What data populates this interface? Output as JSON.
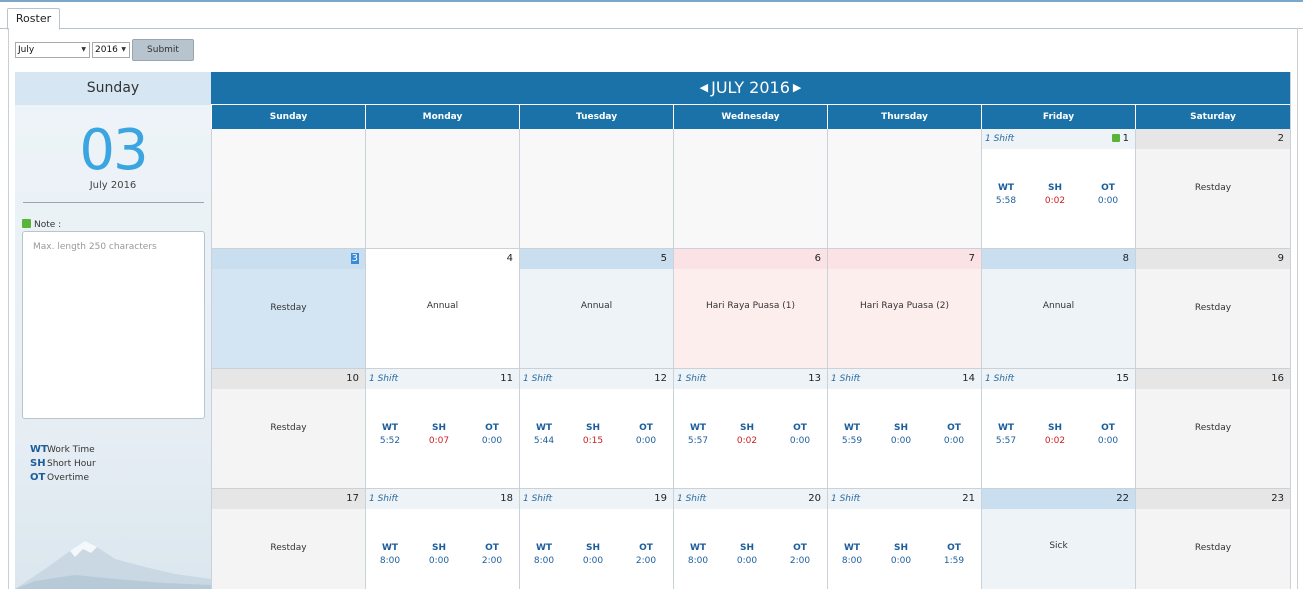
{
  "tab": {
    "label": "Roster"
  },
  "controls": {
    "month": "July",
    "year": "2016",
    "submit_label": "Submit"
  },
  "side": {
    "day_name": "Sunday",
    "date_num": "03",
    "month_year": "July 2016",
    "note_label": "Note :",
    "note_placeholder": "Max. length 250 characters",
    "legend": [
      {
        "key": "WT",
        "text": "Work Time"
      },
      {
        "key": "SH",
        "text": "Short Hour"
      },
      {
        "key": "OT",
        "text": "Overtime"
      }
    ]
  },
  "calendar": {
    "title": "JULY 2016",
    "weekdays": [
      "Sunday",
      "Monday",
      "Tuesday",
      "Wednesday",
      "Thursday",
      "Friday",
      "Saturday"
    ],
    "stat_keys": [
      "WT",
      "SH",
      "OT"
    ],
    "weeks": [
      [
        {
          "num": "",
          "kind": "empty"
        },
        {
          "num": "",
          "kind": "empty"
        },
        {
          "num": "",
          "kind": "empty"
        },
        {
          "num": "",
          "kind": "empty"
        },
        {
          "num": "",
          "kind": "empty"
        },
        {
          "num": "1",
          "kind": "shift",
          "shift": "1 Shift",
          "flag": true,
          "wt": "5:58",
          "sh": "0:02",
          "ot": "0:00",
          "sh_red": true
        },
        {
          "num": "2",
          "kind": "label",
          "label": "Restday",
          "tone": "gray"
        }
      ],
      [
        {
          "num": "3",
          "kind": "label",
          "label": "Restday",
          "tone": "selected"
        },
        {
          "num": "4",
          "kind": "label",
          "label": "Annual",
          "tone": "plain"
        },
        {
          "num": "5",
          "kind": "label",
          "label": "Annual",
          "tone": "plainblue"
        },
        {
          "num": "6",
          "kind": "label",
          "label": "Hari Raya Puasa (1)",
          "tone": "pink"
        },
        {
          "num": "7",
          "kind": "label",
          "label": "Hari Raya Puasa (2)",
          "tone": "pink"
        },
        {
          "num": "8",
          "kind": "label",
          "label": "Annual",
          "tone": "plainblue"
        },
        {
          "num": "9",
          "kind": "label",
          "label": "Restday",
          "tone": "gray"
        }
      ],
      [
        {
          "num": "10",
          "kind": "label",
          "label": "Restday",
          "tone": "gray"
        },
        {
          "num": "11",
          "kind": "shift",
          "shift": "1 Shift",
          "wt": "5:52",
          "sh": "0:07",
          "ot": "0:00",
          "sh_red": true
        },
        {
          "num": "12",
          "kind": "shift",
          "shift": "1 Shift",
          "wt": "5:44",
          "sh": "0:15",
          "ot": "0:00",
          "sh_red": true
        },
        {
          "num": "13",
          "kind": "shift",
          "shift": "1 Shift",
          "wt": "5:57",
          "sh": "0:02",
          "ot": "0:00",
          "sh_red": true
        },
        {
          "num": "14",
          "kind": "shift",
          "shift": "1 Shift",
          "wt": "5:59",
          "sh": "0:00",
          "ot": "0:00",
          "sh_red": false
        },
        {
          "num": "15",
          "kind": "shift",
          "shift": "1 Shift",
          "wt": "5:57",
          "sh": "0:02",
          "ot": "0:00",
          "sh_red": true
        },
        {
          "num": "16",
          "kind": "label",
          "label": "Restday",
          "tone": "gray"
        }
      ],
      [
        {
          "num": "17",
          "kind": "label",
          "label": "Restday",
          "tone": "gray"
        },
        {
          "num": "18",
          "kind": "shift",
          "shift": "1 Shift",
          "wt": "8:00",
          "sh": "0:00",
          "ot": "2:00",
          "sh_red": false
        },
        {
          "num": "19",
          "kind": "shift",
          "shift": "1 Shift",
          "wt": "8:00",
          "sh": "0:00",
          "ot": "2:00",
          "sh_red": false
        },
        {
          "num": "20",
          "kind": "shift",
          "shift": "1 Shift",
          "wt": "8:00",
          "sh": "0:00",
          "ot": "2:00",
          "sh_red": false
        },
        {
          "num": "21",
          "kind": "shift",
          "shift": "1 Shift",
          "wt": "8:00",
          "sh": "0:00",
          "ot": "1:59",
          "sh_red": false
        },
        {
          "num": "22",
          "kind": "label",
          "label": "Sick",
          "tone": "plainblue"
        },
        {
          "num": "23",
          "kind": "label",
          "label": "Restday",
          "tone": "gray"
        }
      ]
    ]
  }
}
